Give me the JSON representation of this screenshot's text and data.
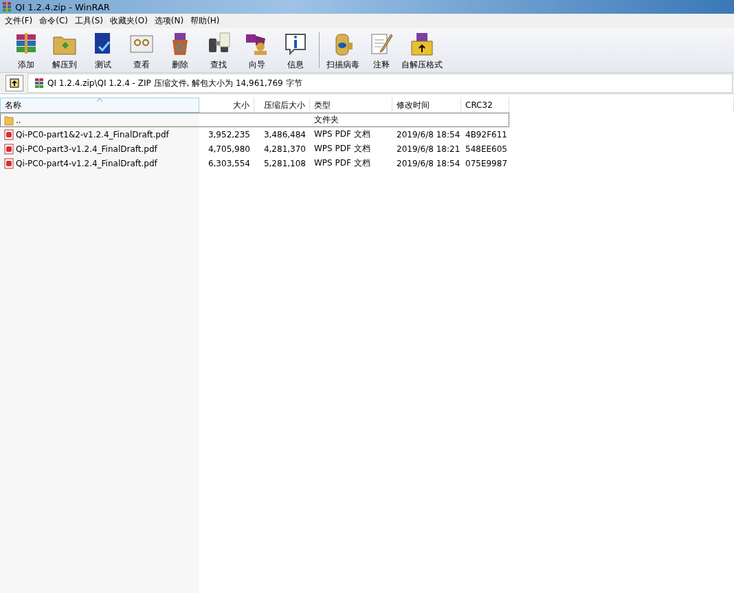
{
  "window": {
    "title": "QI 1.2.4.zip - WinRAR"
  },
  "menu": [
    "文件(F)",
    "命令(C)",
    "工具(S)",
    "收藏夹(O)",
    "选项(N)",
    "帮助(H)"
  ],
  "toolbar": {
    "groups": [
      [
        "添加",
        "解压到",
        "测试",
        "查看",
        "删除",
        "查找",
        "向导",
        "信息"
      ],
      [
        "扫描病毒",
        "注释",
        "自解压格式"
      ]
    ]
  },
  "address": {
    "path": "QI 1.2.4.zip\\QI 1.2.4 - ZIP 压缩文件, 解包大小为 14,961,769 字节"
  },
  "table": {
    "columns": [
      {
        "label": "名称",
        "sorted": true,
        "kind": "text"
      },
      {
        "label": "大小",
        "sorted": false,
        "kind": "number"
      },
      {
        "label": "压缩后大小",
        "sorted": false,
        "kind": "number"
      },
      {
        "label": "类型",
        "sorted": false,
        "kind": "text"
      },
      {
        "label": "修改时间",
        "sorted": false,
        "kind": "text"
      },
      {
        "label": "CRC32",
        "sorted": false,
        "kind": "text"
      }
    ],
    "rows": [
      {
        "kind": "folder",
        "focused": true,
        "cells": [
          "..",
          "",
          "",
          "文件夹",
          "",
          ""
        ]
      },
      {
        "kind": "pdf",
        "focused": false,
        "cells": [
          "Qi-PC0-part1&2-v1.2.4_FinalDraft.pdf",
          "3,952,235",
          "3,486,484",
          "WPS PDF 文档",
          "2019/6/8 18:54",
          "4B92F611"
        ]
      },
      {
        "kind": "pdf",
        "focused": false,
        "cells": [
          "Qi-PC0-part3-v1.2.4_FinalDraft.pdf",
          "4,705,980",
          "4,281,370",
          "WPS PDF 文档",
          "2019/6/8 18:21",
          "548EE605"
        ]
      },
      {
        "kind": "pdf",
        "focused": false,
        "cells": [
          "Qi-PC0-part4-v1.2.4_FinalDraft.pdf",
          "6,303,554",
          "5,281,108",
          "WPS PDF 文档",
          "2019/6/8 18:54",
          "075E9987"
        ]
      }
    ]
  }
}
